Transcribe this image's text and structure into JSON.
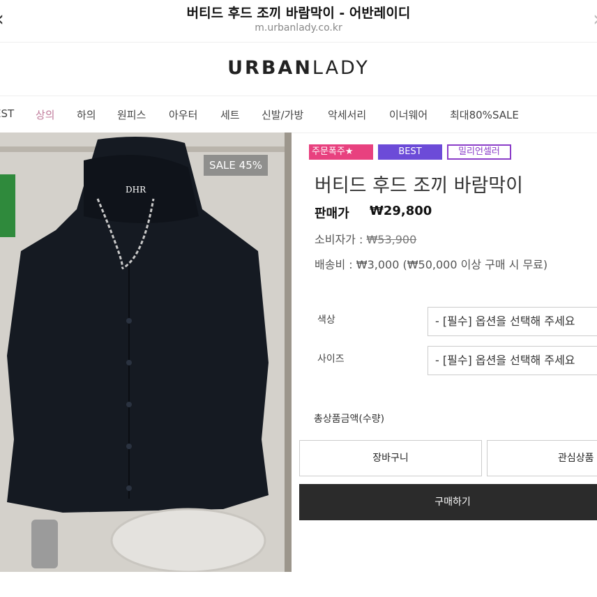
{
  "browser": {
    "title": "버티드 후드 조끼 바람막이 - 어반레이디",
    "url": "m.urbanlady.co.kr",
    "back_icon": "chevron-left-icon",
    "forward_icon": "chevron-right-icon"
  },
  "logo": {
    "bold": "URBAN",
    "light": "LADY"
  },
  "categories": [
    "EST",
    "상의",
    "하의",
    "원피스",
    "아우터",
    "세트",
    "신발/가방",
    "악세서리",
    "이너웨어",
    "최대80%SALE"
  ],
  "active_category": "상의",
  "product": {
    "sale_badge": "SALE 45%",
    "image_text": "DHR",
    "badges": [
      "주문폭주★",
      "BEST",
      "밀리언셀러"
    ],
    "name": "버티드 후드 조끼 바람막이",
    "price_label": "판매가",
    "price": "₩29,800",
    "consumer_label": "소비자가",
    "consumer_price": "₩53,900",
    "shipping_label": "배송비",
    "shipping": "₩3,000 (₩50,000 이상 구매 시 무료)"
  },
  "options": [
    {
      "label": "색상",
      "value": "- [필수] 옵션을 선택해 주세요"
    },
    {
      "label": "사이즈",
      "value": "- [필수] 옵션을 선택해 주세요"
    }
  ],
  "total_label": "총상품금액(수량)",
  "buttons": {
    "cart": "장바구니",
    "wish": "관심상품",
    "buy": "구매하기"
  },
  "colors": {
    "accent_pink": "#e8417f",
    "best_purple": "#6c4bd8",
    "active_nav": "#c07a9a",
    "buy_button": "#2b2b2b"
  }
}
